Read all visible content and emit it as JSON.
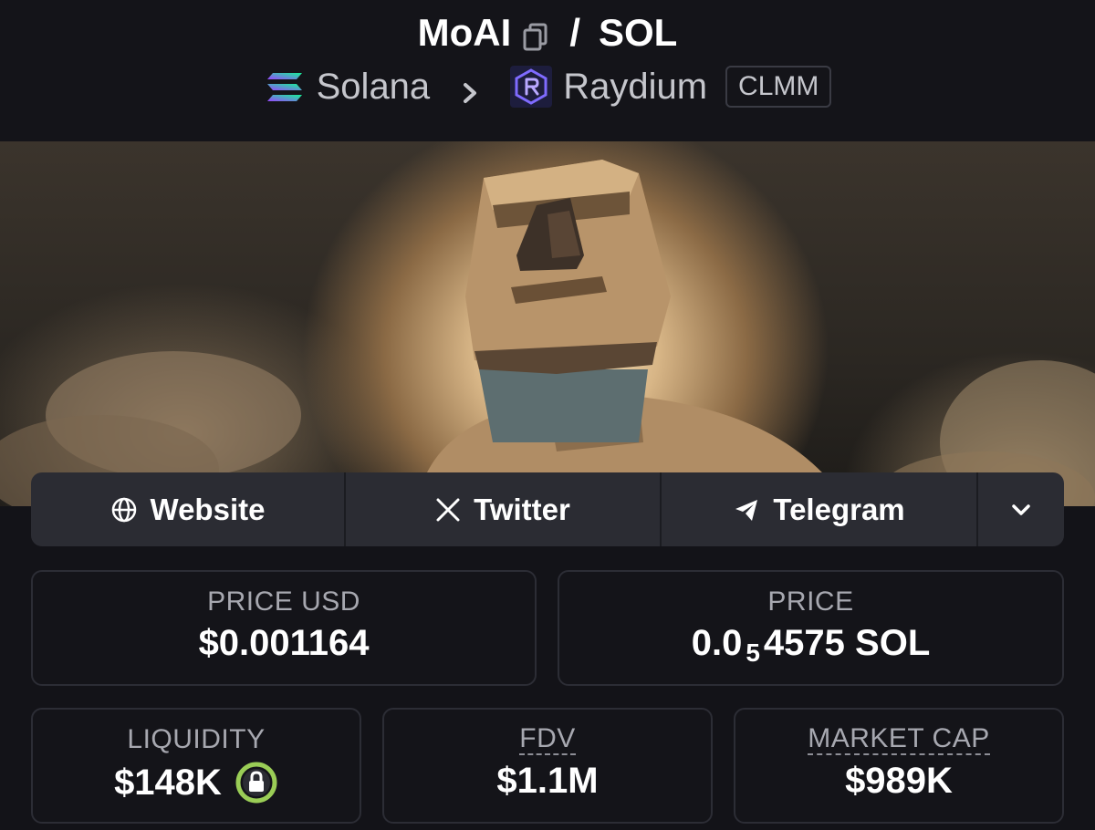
{
  "header": {
    "token": "MoAI",
    "separator": "/",
    "quote": "SOL",
    "chain": "Solana",
    "dex": "Raydium",
    "pool_type": "CLMM"
  },
  "icons": {
    "copy": "copy-icon",
    "chain": "solana-logo-icon",
    "breadcrumb": "chevron-right-icon",
    "dex": "raydium-logo-icon",
    "website": "globe-icon",
    "twitter": "x-icon",
    "telegram": "telegram-icon",
    "more": "chevron-down-icon",
    "lock": "lock-icon"
  },
  "links": {
    "website": "Website",
    "twitter": "Twitter",
    "telegram": "Telegram"
  },
  "stats": {
    "price_usd": {
      "label": "PRICE USD",
      "value": "$0.001164"
    },
    "price": {
      "label": "PRICE",
      "prefix": "0.0",
      "zeros": "5",
      "suffix": "4575 SOL"
    },
    "liquidity": {
      "label": "LIQUIDITY",
      "value": "$148K"
    },
    "fdv": {
      "label": "FDV",
      "value": "$1.1M"
    },
    "market_cap": {
      "label": "MARKET CAP",
      "value": "$989K"
    }
  },
  "colors": {
    "background": "#131318",
    "panel": "#2b2c33",
    "lock_ring": "#9acd56"
  }
}
